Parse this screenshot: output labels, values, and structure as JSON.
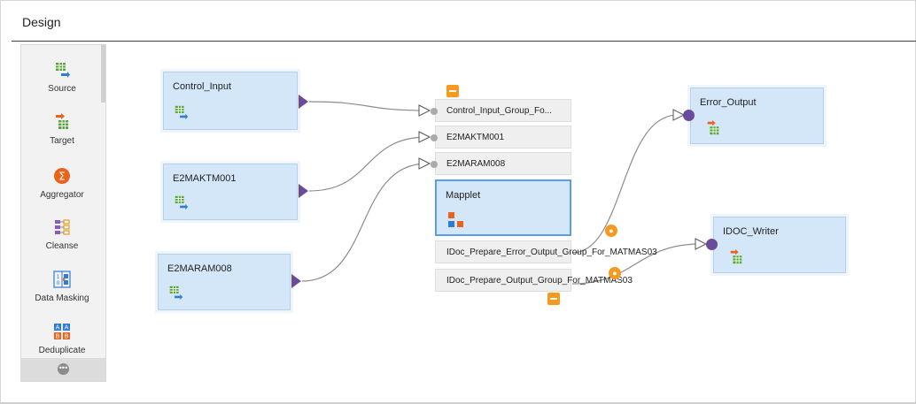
{
  "panel": {
    "title": "Design"
  },
  "palette": {
    "items": [
      {
        "label": "Source"
      },
      {
        "label": "Target"
      },
      {
        "label": "Aggregator"
      },
      {
        "label": "Cleanse"
      },
      {
        "label": "Data Masking"
      },
      {
        "label": "Deduplicate"
      }
    ],
    "more_glyph": "•••"
  },
  "nodes": {
    "control_input": "Control_Input",
    "e2maktm001": "E2MAKTM001",
    "e2maram008": "E2MARAM008",
    "error_output": "Error_Output",
    "idoc_writer": "IDOC_Writer"
  },
  "mapplet": {
    "title": "Mapplet",
    "input_groups": [
      "Control_Input_Group_Fo...",
      "E2MAKTM001",
      "E2MARAM008"
    ],
    "output_groups": [
      "IDoc_Prepare_Error_Output_Group_For_MATMAS03",
      "IDoc_Prepare_Output_Group_For_MATMAS03"
    ]
  },
  "colors": {
    "node_fill": "#d4e7f8",
    "port": "#6a4a9a",
    "accent": "#f59a1f",
    "selected_border": "#5a9ee6"
  }
}
